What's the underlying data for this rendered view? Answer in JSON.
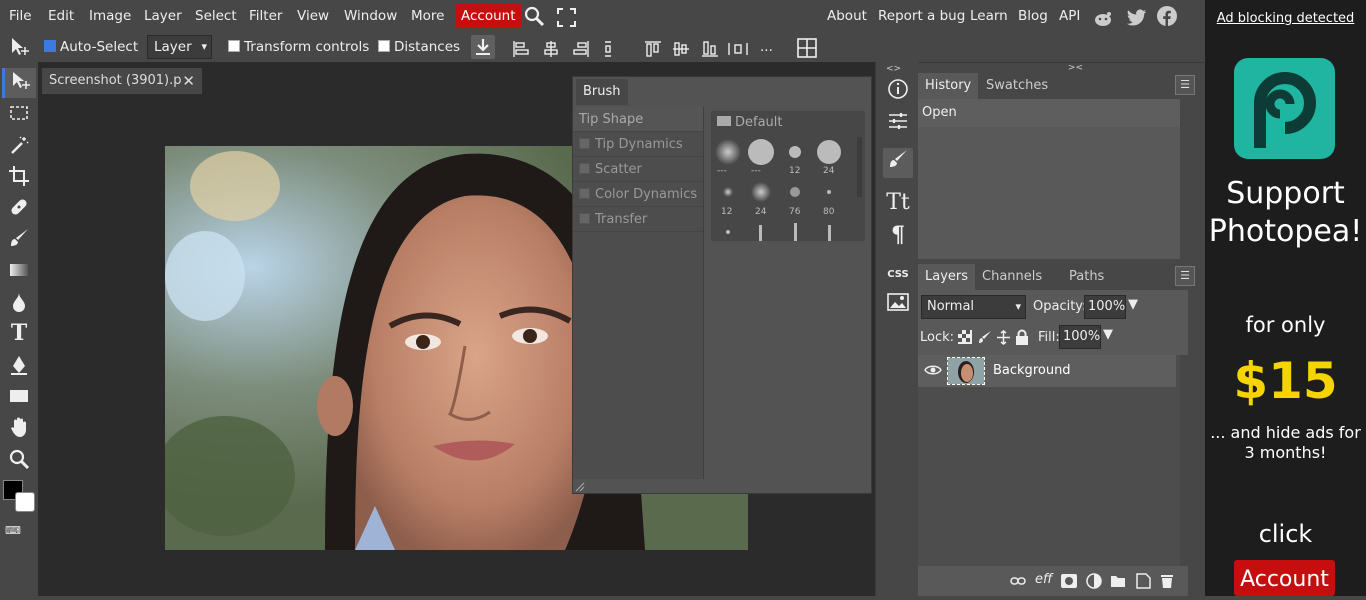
{
  "menu": {
    "file": "File",
    "edit": "Edit",
    "image": "Image",
    "layer": "Layer",
    "select": "Select",
    "filter": "Filter",
    "view": "View",
    "window": "Window",
    "more": "More",
    "account": "Account",
    "about": "About",
    "report_bug": "Report a bug",
    "learn": "Learn",
    "blog": "Blog",
    "api": "API"
  },
  "options": {
    "auto_select": "Auto-Select",
    "layer_select": "Layer",
    "transform_controls": "Transform controls",
    "distances": "Distances",
    "ellipsis": "..."
  },
  "document": {
    "tab_title": "Screenshot (3901).p"
  },
  "brush": {
    "tab": "Brush",
    "sections": [
      "Tip Shape",
      "Tip Dynamics",
      "Scatter",
      "Color Dynamics",
      "Transfer"
    ],
    "folder": "Default",
    "sizes_row1": [
      "---",
      "---",
      "12",
      "24"
    ],
    "sizes_row2": [
      "12",
      "24",
      "76",
      "80"
    ]
  },
  "history": {
    "tab_history": "History",
    "tab_swatches": "Swatches",
    "items": [
      "Open"
    ]
  },
  "layers": {
    "tab_layers": "Layers",
    "tab_channels": "Channels",
    "tab_paths": "Paths",
    "blend_mode": "Normal",
    "opacity_label": "Opacity:",
    "opacity_value": "100%",
    "lock_label": "Lock:",
    "fill_label": "Fill:",
    "fill_value": "100%",
    "layer_name": "Background",
    "footer_eff": "eff"
  },
  "side_strip": {
    "css_label": "CSS"
  },
  "ad": {
    "adblock": "Ad blocking detected",
    "support": "Support Photopea!",
    "for_only": "for only",
    "price": "$15",
    "hide_ads": "... and hide ads for 3 months!",
    "click": "click",
    "account": "Account"
  },
  "colors": {
    "accent_red": "#c70e0e",
    "price_yellow": "#f5d400",
    "logo_teal": "#1fb5a0"
  }
}
